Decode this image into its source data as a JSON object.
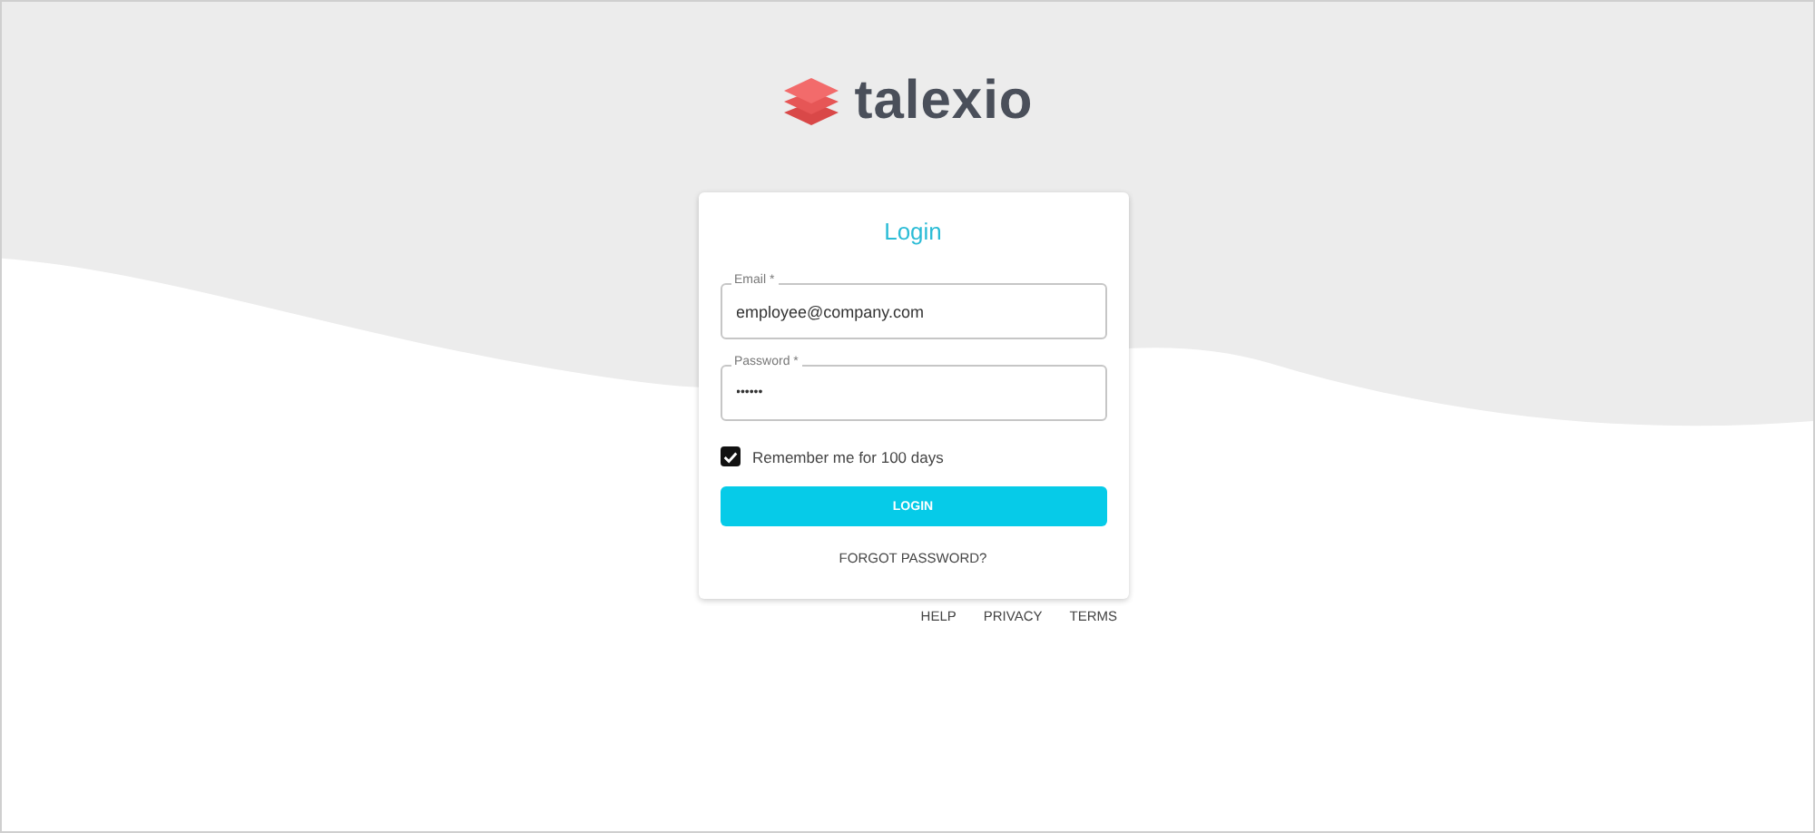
{
  "logo": {
    "text": "talexio"
  },
  "login": {
    "title": "Login",
    "email": {
      "label": "Email *",
      "value": "employee@company.com"
    },
    "password": {
      "label": "Password *",
      "value": "••••••"
    },
    "remember": {
      "label": "Remember me for 100 days",
      "checked": true
    },
    "submit": "LOGIN",
    "forgot": "FORGOT PASSWORD?"
  },
  "footer_links": [
    "HELP",
    "PRIVACY",
    "TERMS"
  ]
}
